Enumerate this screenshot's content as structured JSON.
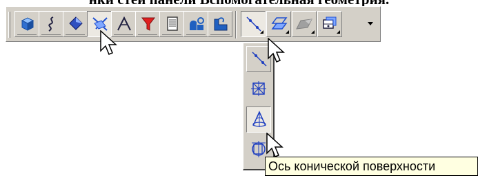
{
  "caption": {
    "text": "нки стеи панели Вспомогательная геометрия."
  },
  "toolbar": {
    "buttons": [
      {
        "icon": "extrude-solid-icon",
        "color": "#3a7fd5"
      },
      {
        "icon": "curve-icon",
        "color": "#202040"
      },
      {
        "icon": "surface-icon",
        "color": "#2040a0"
      },
      {
        "icon": "auxiliary-geometry-icon",
        "color": "#2050d0"
      },
      {
        "icon": "axis-angle-icon",
        "color": "#202040"
      },
      {
        "icon": "filter-icon",
        "color": "#c01818"
      },
      {
        "icon": "specification-icon",
        "color": "#404040"
      },
      {
        "icon": "measure-icon",
        "color": "#2060c0"
      },
      {
        "icon": "edit-part-icon",
        "color": "#2060c0"
      },
      {
        "icon": "axis-two-points-icon",
        "color": "#2040c0"
      },
      {
        "icon": "offset-plane-icon",
        "color": "#2050d0"
      },
      {
        "icon": "plane-tangent-icon",
        "color": "#808080"
      },
      {
        "icon": "control-point-icon",
        "color": "#2050d0"
      }
    ],
    "more_icon": "dropdown-arrow-icon"
  },
  "flyout": {
    "items": [
      {
        "icon": "axis-through-two-vertices-icon"
      },
      {
        "icon": "axis-through-edge-icon"
      },
      {
        "icon": "conical-surface-axis-icon"
      },
      {
        "icon": "axis-of-operation-icon"
      }
    ]
  },
  "tooltip": {
    "text": "Ось конической поверхности"
  },
  "colors": {
    "toolbar_face": "#d4d0c8",
    "tooltip_bg": "#ffffe1",
    "icon_blue": "#2040c0"
  }
}
